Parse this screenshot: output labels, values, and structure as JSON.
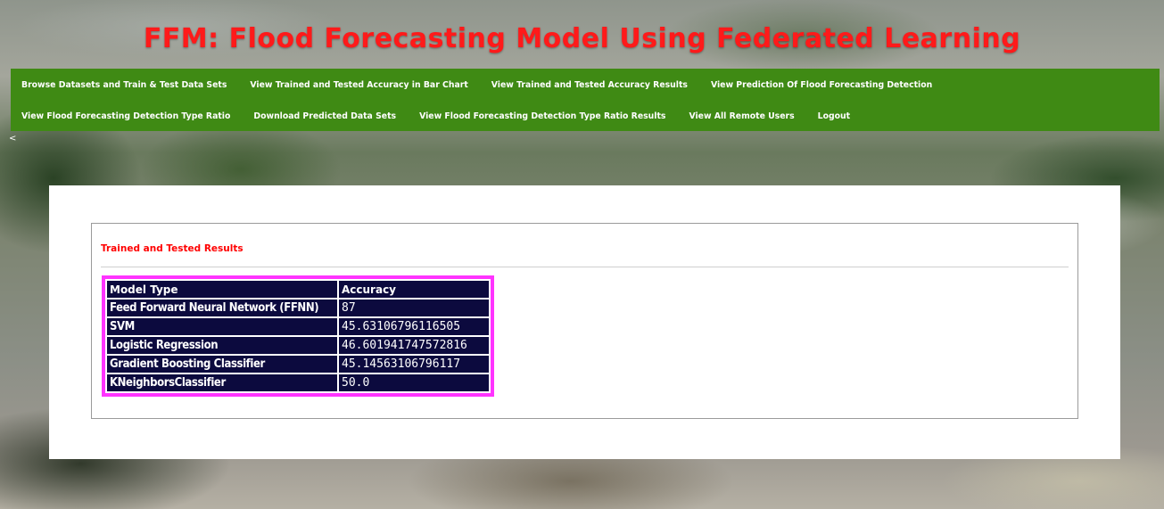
{
  "header": {
    "title": "FFM: Flood Forecasting Model Using Federated Learning"
  },
  "nav": {
    "row1": [
      "Browse Datasets and Train & Test Data Sets",
      "View Trained and Tested Accuracy in Bar Chart",
      "View Trained and Tested Accuracy Results",
      "View Prediction Of Flood Forecasting Detection"
    ],
    "row2": [
      "View Flood Forecasting Detection Type Ratio",
      "Download Predicted Data Sets",
      "View Flood Forecasting Detection Type Ratio Results",
      "View All Remote Users",
      "Logout"
    ]
  },
  "back_glyph": "<",
  "results": {
    "heading": "Trained and Tested Results",
    "columns": [
      "Model Type",
      "Accuracy"
    ],
    "rows": [
      {
        "model": "Feed Forward Neural Network (FFNN)",
        "accuracy": "87"
      },
      {
        "model": "SVM",
        "accuracy": "45.63106796116505"
      },
      {
        "model": "Logistic Regression",
        "accuracy": "46.601941747572816"
      },
      {
        "model": "Gradient Boosting Classifier",
        "accuracy": "45.14563106796117"
      },
      {
        "model": "KNeighborsClassifier",
        "accuracy": "50.0"
      }
    ]
  },
  "colors": {
    "title_red": "#ff1a1a",
    "nav_green": "#3f8a14",
    "heading_red": "#ff0000",
    "table_border_magenta": "#ff33ff",
    "table_cell_navy": "#0c0a3e"
  }
}
